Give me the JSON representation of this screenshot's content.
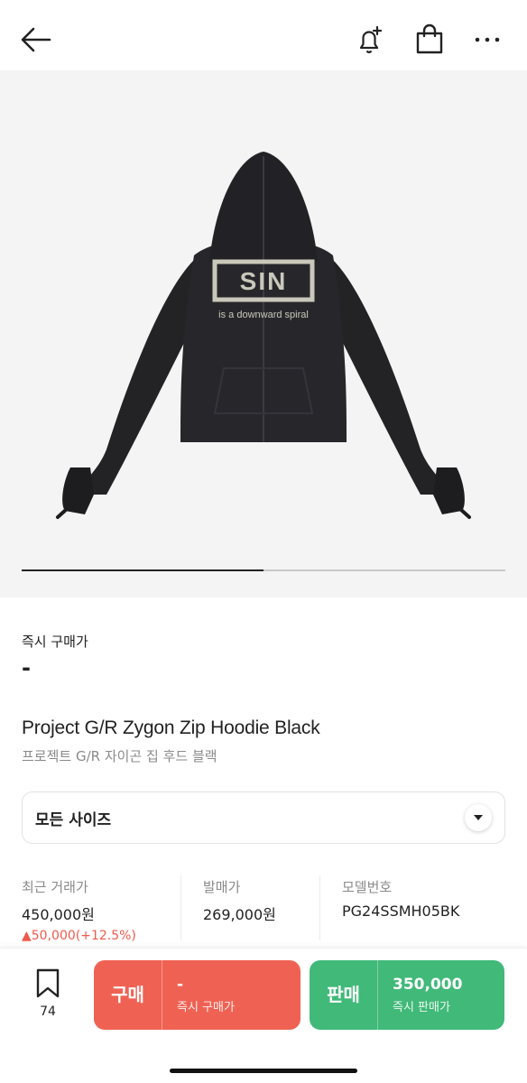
{
  "header": {
    "back_icon": "arrow-left-icon",
    "alarm_icon": "bell-plus-icon",
    "bag_icon": "shopping-bag-icon",
    "more_icon": "more-horizontal-icon"
  },
  "product_image": {
    "print_logo": "SIN",
    "print_text": "is a downward spiral",
    "carousel_progress": 0.5
  },
  "price": {
    "label": "즉시 구매가",
    "value": "-"
  },
  "product": {
    "title_en": "Project G/R Zygon Zip Hoodie Black",
    "title_ko": "프로젝트 G/R 자이곤 집 후드 블랙"
  },
  "size_select": {
    "label": "모든 사이즈",
    "icon": "chevron-down-icon"
  },
  "info": {
    "recent_label": "최근 거래가",
    "recent_value": "450,000원",
    "recent_change": "▲50,000(+12.5%)",
    "release_label": "발매가",
    "release_value": "269,000원",
    "model_label": "모델번호",
    "model_value": "PG24SSMH05BK"
  },
  "bottom": {
    "wish_icon": "bookmark-icon",
    "wish_count": "74",
    "buy_tag": "구매",
    "buy_price": "-",
    "buy_sub": "즉시 구매가",
    "sell_tag": "판매",
    "sell_price": "350,000",
    "sell_sub": "즉시 판매가"
  },
  "colors": {
    "buy": "#ef6253",
    "sell": "#41b979",
    "price_up": "#ef5a4d"
  }
}
